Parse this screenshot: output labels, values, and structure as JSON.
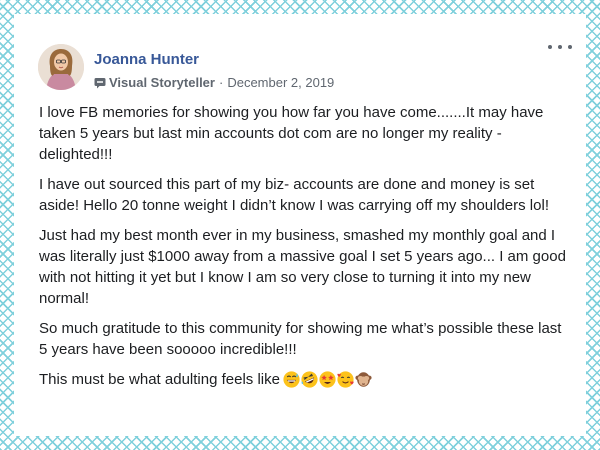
{
  "post": {
    "author": {
      "name": "Joanna Hunter",
      "avatar_icon": "woman-avatar-icon"
    },
    "badge": {
      "icon": "storyteller-badge-icon",
      "label": "Visual Storyteller"
    },
    "separator": "·",
    "date": "December 2, 2019",
    "menu_icon": "more-options-icon",
    "paragraphs": [
      "I love FB memories for showing you how far you have come.......It may have taken 5 years but last min accounts dot com are no longer my reality - delighted!!!",
      "I have out sourced this part of my biz- accounts are done and money is set aside! Hello 20 tonne weight I didn’t know I was carrying off my shoulders lol!",
      "Just had my best month ever in my business, smashed my monthly goal and I was literally just $1000 away from a massive goal I set 5 years ago... I am good with not hitting it yet but I know I am so very close to turning it into my new normal!",
      "So much gratitude to this community for showing me what’s possible these last 5 years have been sooooo incredible!!!"
    ],
    "last_line": "This must be what adulting feels like",
    "emojis": [
      "grinning-sweat-emoji",
      "rofl-emoji",
      "star-struck-emoji",
      "smiling-hearts-emoji",
      "see-no-evil-monkey-emoji"
    ]
  },
  "colors": {
    "name": "#385898",
    "meta": "#606770",
    "text": "#1c1e21",
    "border_pattern": "#7fd0dc"
  }
}
